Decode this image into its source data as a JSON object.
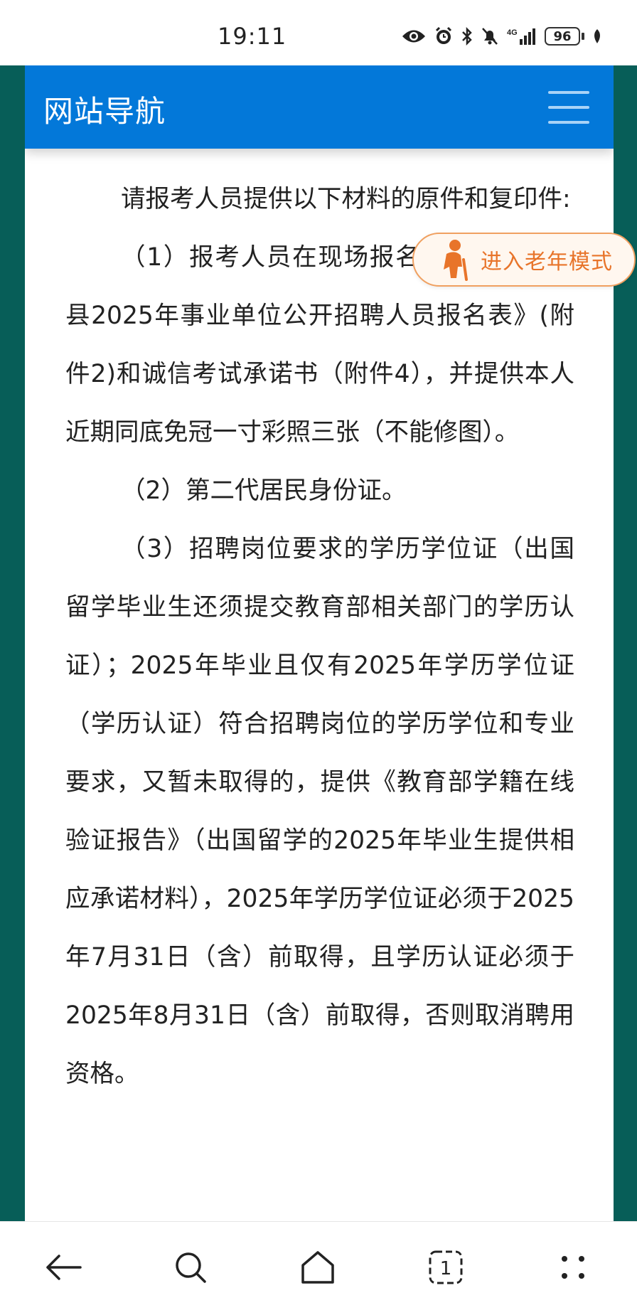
{
  "status_bar": {
    "time": "19:11",
    "network": "4G",
    "battery": "96",
    "icons": [
      "eye-icon",
      "alarm-icon",
      "bluetooth-icon",
      "mute-icon",
      "signal-icon",
      "battery-icon",
      "leaf-icon"
    ]
  },
  "header": {
    "title": "网站导航",
    "menu_icon": "hamburger-menu-icon"
  },
  "elder_mode": {
    "label": "进入老年模式",
    "icon": "elderly-person-icon"
  },
  "article": {
    "paragraphs": [
      "请报考人员提供以下材料的原件和复印件:",
      "（1）报考人员在现场报名时填写《岳阳县2025年事业单位公开招聘人员报名表》(附件2)和诚信考试承诺书（附件4），并提供本人近期同底免冠一寸彩照三张（不能修图）。",
      "（2）第二代居民身份证。",
      "（3）招聘岗位要求的学历学位证（出国留学毕业生还须提交教育部相关部门的学历认证）；2025年毕业且仅有2025年学历学位证（学历认证）符合招聘岗位的学历学位和专业要求，又暂未取得的，提供《教育部学籍在线验证报告》（出国留学的2025年毕业生提供相应承诺材料），2025年学历学位证必须于2025年7月31日（含）前取得，且学历认证必须于2025年8月31日（含）前取得，否则取消聘用资格。"
    ]
  },
  "bottom_nav": {
    "tab_count": "1",
    "items": [
      "back-arrow-icon",
      "search-icon",
      "home-icon",
      "tabs-icon",
      "more-dots-icon"
    ]
  },
  "colors": {
    "header_blue": "#0378d9",
    "side_teal": "#075e58",
    "elder_orange": "#e8742a"
  }
}
